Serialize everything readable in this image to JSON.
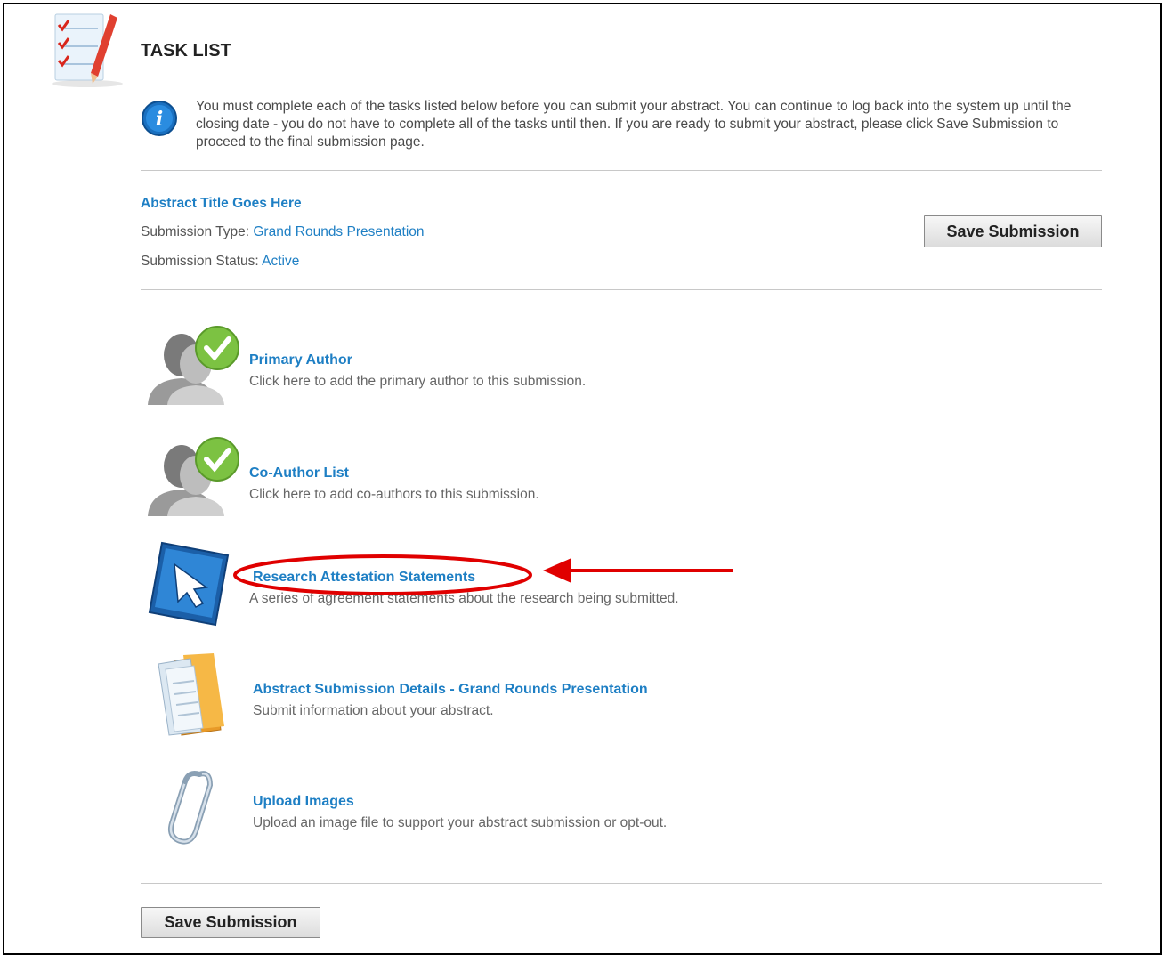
{
  "page": {
    "title": "TASK LIST"
  },
  "info": {
    "icon": "info-icon",
    "text": "You must complete each of the tasks listed below before you can submit your abstract. You can continue to log back into the system up until the closing date - you do not have to complete all of the tasks until then. If you are ready to submit your abstract, please click Save Submission to proceed to the final submission page."
  },
  "submission": {
    "abstract_title": "Abstract Title Goes Here",
    "type_label": "Submission Type:",
    "type_value": "Grand Rounds Presentation",
    "status_label": "Submission Status:",
    "status_value": "Active",
    "save_label": "Save Submission"
  },
  "tasks": [
    {
      "title": "Primary Author",
      "desc": "Click here to add the primary author to this submission.",
      "icon": "user-check-icon"
    },
    {
      "title": "Co-Author List",
      "desc": "Click here to add co-authors to this submission.",
      "icon": "users-check-icon"
    },
    {
      "title": "Research Attestation Statements",
      "desc": "A series of agreement statements about the research being submitted.",
      "icon": "cursor-arrow-icon"
    },
    {
      "title": "Abstract Submission Details - Grand Rounds Presentation",
      "desc": "Submit information about your abstract.",
      "icon": "folder-documents-icon"
    },
    {
      "title": "Upload Images",
      "desc": "Upload an image file to support your abstract submission or opt-out.",
      "icon": "paperclip-icon"
    }
  ],
  "footer": {
    "save_label": "Save Submission"
  },
  "colors": {
    "link": "#1e7fc4",
    "annotation": "#e00000",
    "check": "#7cc242"
  }
}
